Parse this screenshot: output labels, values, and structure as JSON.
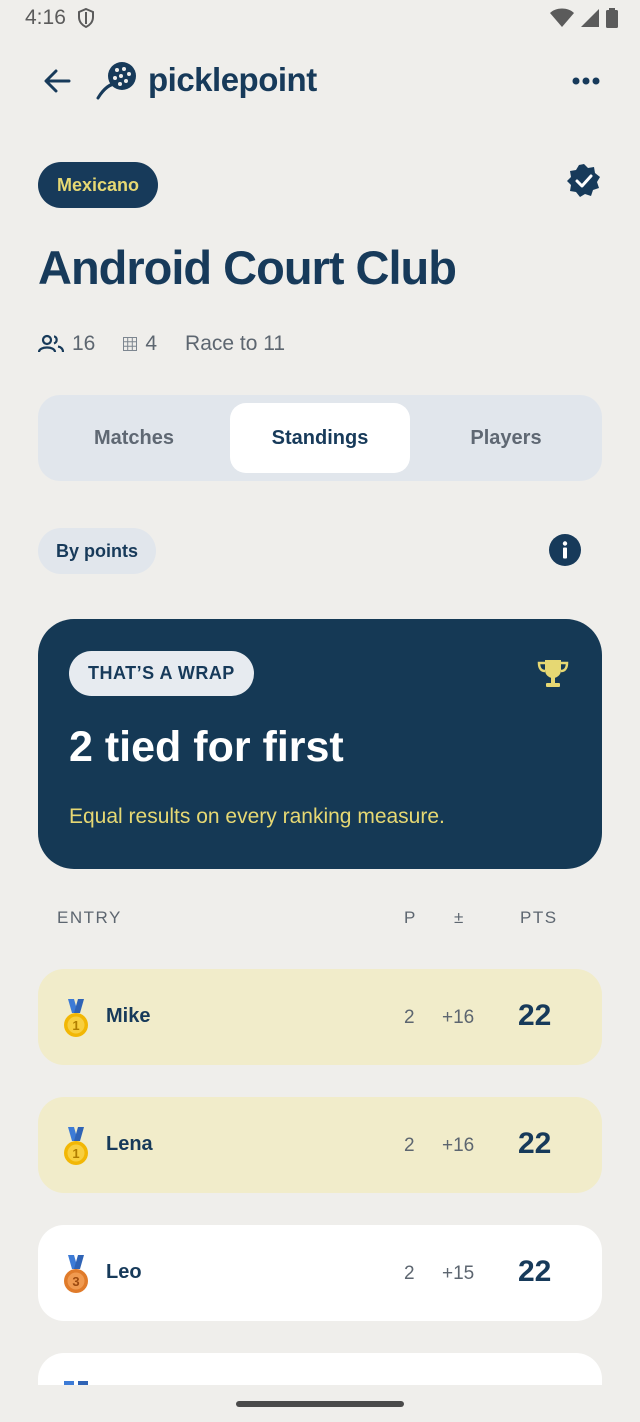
{
  "status_bar": {
    "time": "4:16"
  },
  "app_bar": {
    "brand": "picklepoint"
  },
  "event": {
    "mode": "Mexicano",
    "title": "Android Court Club",
    "players": "16",
    "courts": "4",
    "race": "Race to 11"
  },
  "tabs": [
    {
      "label": "Matches",
      "active": false
    },
    {
      "label": "Standings",
      "active": true
    },
    {
      "label": "Players",
      "active": false
    }
  ],
  "sort": {
    "label": "By points"
  },
  "result_card": {
    "pill": "THAT’S A WRAP",
    "headline": "2 tied for first",
    "subtitle": "Equal results on every ranking measure."
  },
  "table": {
    "headers": {
      "entry": "ENTRY",
      "played": "P",
      "diff": "±",
      "points": "PTS"
    },
    "rows": [
      {
        "name": "Mike",
        "played": "2",
        "diff": "+16",
        "points": "22",
        "medal": "gold",
        "medal_number": "1"
      },
      {
        "name": "Lena",
        "played": "2",
        "diff": "+16",
        "points": "22",
        "medal": "gold",
        "medal_number": "1"
      },
      {
        "name": "Leo",
        "played": "2",
        "diff": "+15",
        "points": "22",
        "medal": "bronze",
        "medal_number": "3"
      }
    ]
  },
  "colors": {
    "primary": "#173a5a",
    "accent_yellow": "#e6d873",
    "tie_row_bg": "#f1ecca",
    "background": "#efeeeb"
  }
}
